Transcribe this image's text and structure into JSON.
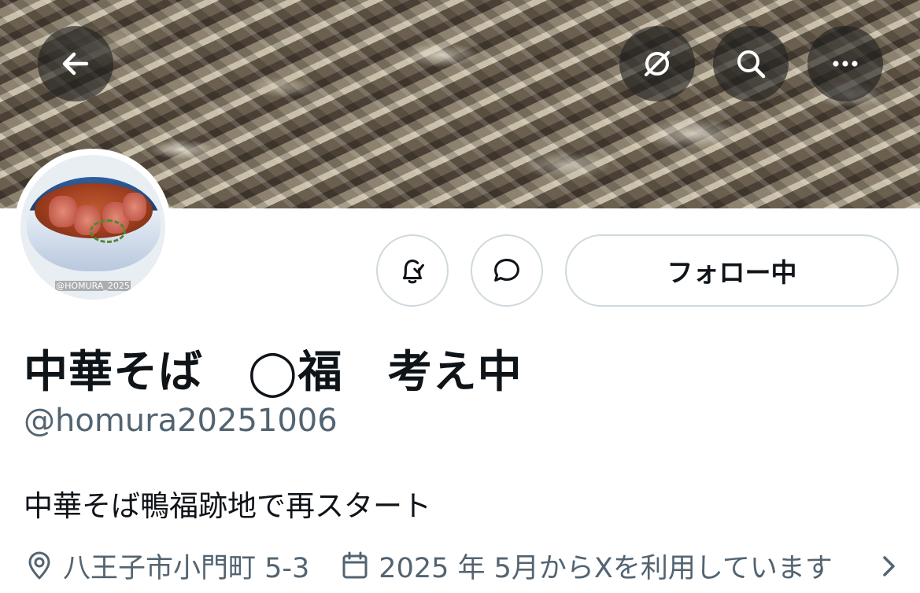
{
  "header": {
    "back_icon": "arrow-left-icon",
    "grok_icon": "slashed-circle-icon",
    "search_icon": "search-icon",
    "more_icon": "more-horizontal-icon"
  },
  "profile": {
    "avatar_watermark": "@HOMURA_2025",
    "display_name": "中華そば　◯福　考え中",
    "handle": "@homura20251006",
    "bio": "中華そば鴨福跡地で再スタート",
    "location": "八王子市小門町 5-3",
    "joined": "2025 年 5月からXを利用しています"
  },
  "actions": {
    "notify_icon": "bell-check-icon",
    "message_icon": "message-bubble-icon",
    "follow_label": "フォロー中"
  },
  "colors": {
    "secondary_text": "#536471",
    "button_border": "#cfd9de",
    "header_button_bg": "rgba(30,30,30,0.62)"
  }
}
